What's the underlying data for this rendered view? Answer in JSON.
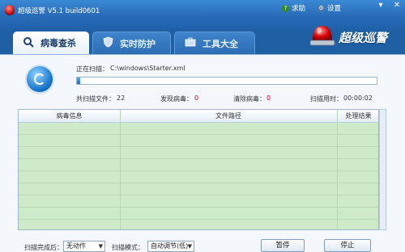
{
  "app": {
    "title": "超级巡警 V5.1 build0601"
  },
  "topbar": {
    "help_label": "求助",
    "settings_label": "设置"
  },
  "window_buttons": {
    "minimize": "▾",
    "close": "✕"
  },
  "tabs": [
    {
      "label": "病毒查杀",
      "icon": "search-icon",
      "active": true
    },
    {
      "label": "实时防护",
      "icon": "shield-icon",
      "active": false
    },
    {
      "label": "工具大全",
      "icon": "toolbox-icon",
      "active": false
    }
  ],
  "brand": {
    "text": "超级巡警",
    "icon": "siren-icon"
  },
  "scan": {
    "current_label": "正在扫描：",
    "current_file": "C:\\windows\\Starter.xml",
    "progress": 0.01,
    "files_label": "共扫描文件：",
    "files_value": "22",
    "found_label": "发现病毒：",
    "found_value": "0",
    "cleared_label": "清除病毒：",
    "cleared_value": "0",
    "time_label": "扫描用时：",
    "time_value": "00:00:02"
  },
  "results": {
    "columns": [
      "病毒信息",
      "文件路径",
      "处理结果"
    ],
    "rows": []
  },
  "bottom": {
    "after_scan_label": "扫描完成后：",
    "after_scan_value": "无动作",
    "mode_label": "扫描模式：",
    "mode_value": "自动调节(低)",
    "pause_label": "暂停",
    "stop_label": "停止"
  },
  "colors": {
    "titlebar": "#2a6fbc",
    "grid_bg": "#cfeac9",
    "alert_red": "#e00000",
    "progress_fill": "#1e6ec9"
  }
}
